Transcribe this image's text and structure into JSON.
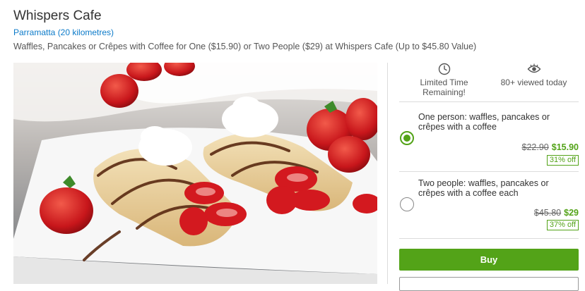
{
  "deal": {
    "title": "Whispers Cafe",
    "location": "Parramatta (20 kilometres)",
    "subtitle": "Waffles, Pancakes or Crêpes with Coffee for One ($15.90) or Two People ($29) at Whispers Cafe (Up to $45.80 Value)"
  },
  "info": {
    "time_line1": "Limited Time",
    "time_line2": "Remaining!",
    "views": "80+ viewed today",
    "time_icon": "clock-icon",
    "views_icon": "eye-icon"
  },
  "options": [
    {
      "line1": "One person: waffles, pancakes or",
      "line2": "crêpes with a coffee",
      "original_price": "$22.90",
      "price": "$15.90",
      "discount": "31% off",
      "selected": true
    },
    {
      "line1": "Two people: waffles, pancakes or",
      "line2": "crêpes with a coffee each",
      "original_price": "$45.80",
      "price": "$29",
      "discount": "37% off",
      "selected": false
    }
  ],
  "actions": {
    "buy_label": "Buy"
  },
  "colors": {
    "accent": "#53a318",
    "link": "#0b7ac9"
  }
}
